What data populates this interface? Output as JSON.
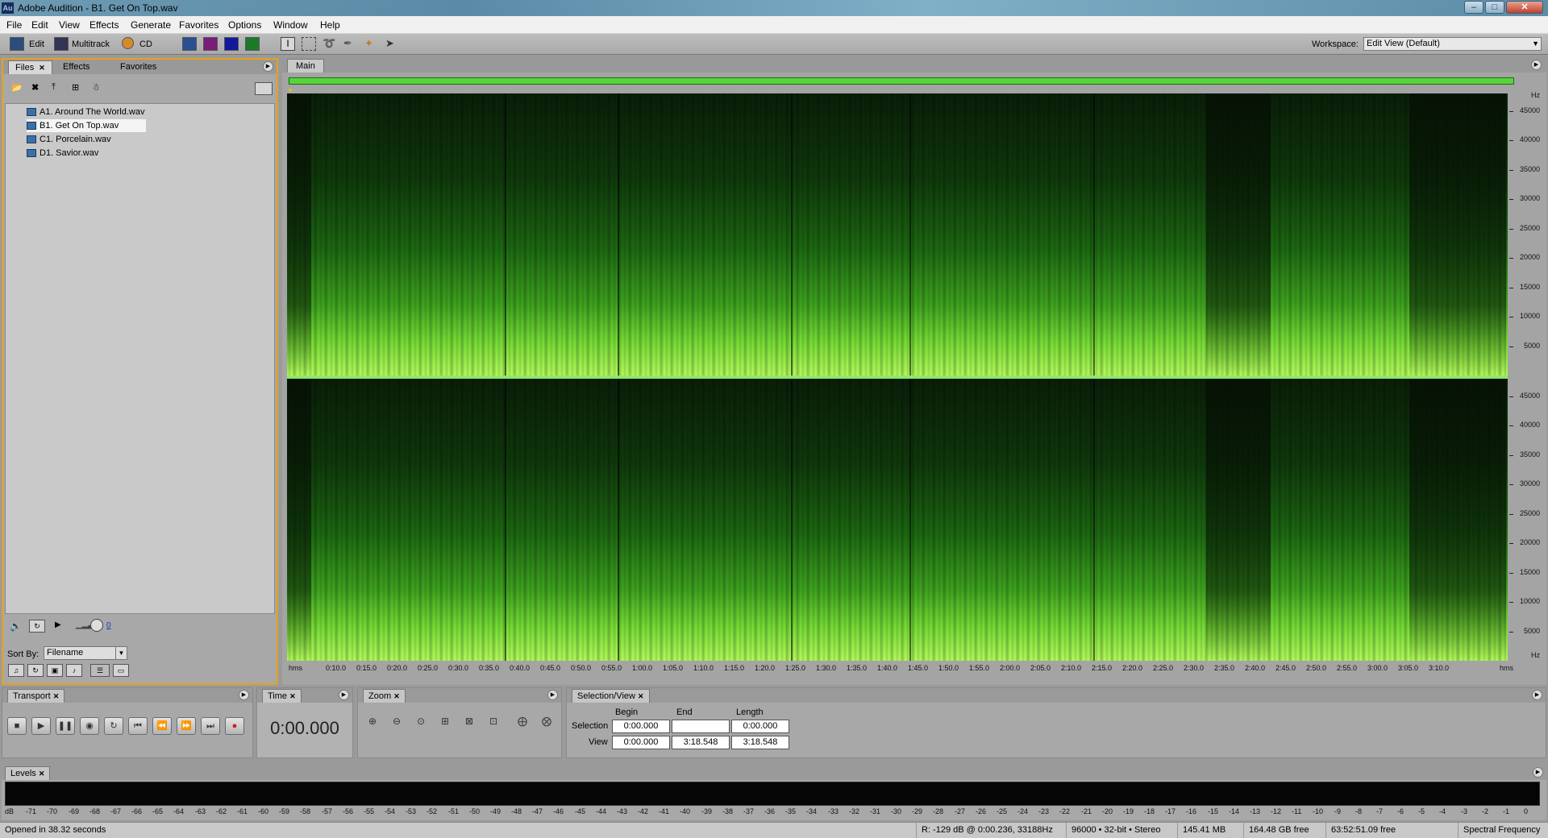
{
  "window": {
    "app_icon": "Au",
    "title": "Adobe Audition - B1. Get On Top.wav",
    "minimize": "–",
    "maximize": "□",
    "close": "✕"
  },
  "menu": [
    "File",
    "Edit",
    "View",
    "Effects",
    "Generate",
    "Favorites",
    "Options",
    "Window",
    "Help"
  ],
  "toolbar": {
    "modes": [
      "Edit",
      "Multitrack",
      "CD"
    ],
    "workspace_label": "Workspace:",
    "workspace_value": "Edit View (Default)"
  },
  "files_panel": {
    "tabs": [
      "Files",
      "Effects",
      "Favorites"
    ],
    "files": [
      "A1. Around The World.wav",
      "B1. Get On Top.wav",
      "C1. Porcelain.wav",
      "D1. Savior.wav"
    ],
    "selected_index": 1,
    "volume_value": "0",
    "sort_by_label": "Sort By:",
    "sort_by_value": "Filename"
  },
  "main_panel": {
    "tab": "Main",
    "freq_unit": "Hz",
    "freq_labels": [
      "45000",
      "40000",
      "35000",
      "30000",
      "25000",
      "20000",
      "15000",
      "10000",
      "5000"
    ],
    "time_unit_start": "hms",
    "time_unit_end": "hms",
    "time_labels": [
      "0:10.0",
      "0:15.0",
      "0:20.0",
      "0:25.0",
      "0:30.0",
      "0:35.0",
      "0:40.0",
      "0:45.0",
      "0:50.0",
      "0:55.0",
      "1:00.0",
      "1:05.0",
      "1:10.0",
      "1:15.0",
      "1:20.0",
      "1:25.0",
      "1:30.0",
      "1:35.0",
      "1:40.0",
      "1:45.0",
      "1:50.0",
      "1:55.0",
      "2:00.0",
      "2:05.0",
      "2:10.0",
      "2:15.0",
      "2:20.0",
      "2:25.0",
      "2:30.0",
      "2:35.0",
      "2:40.0",
      "2:45.0",
      "2:50.0",
      "2:55.0",
      "3:00.0",
      "3:05.0",
      "3:10.0"
    ]
  },
  "transport": {
    "tab": "Transport"
  },
  "time_panel": {
    "tab": "Time",
    "value": "0:00.000"
  },
  "zoom_panel": {
    "tab": "Zoom"
  },
  "selection_view": {
    "tab": "Selection/View",
    "headers": [
      "Begin",
      "End",
      "Length"
    ],
    "selection_label": "Selection",
    "view_label": "View",
    "selection": [
      "0:00.000",
      "",
      "0:00.000"
    ],
    "view": [
      "0:00.000",
      "3:18.548",
      "3:18.548"
    ]
  },
  "levels": {
    "tab": "Levels",
    "scale": [
      "dB",
      "-71",
      "-70",
      "-69",
      "-68",
      "-67",
      "-66",
      "-65",
      "-64",
      "-63",
      "-62",
      "-61",
      "-60",
      "-59",
      "-58",
      "-57",
      "-56",
      "-55",
      "-54",
      "-53",
      "-52",
      "-51",
      "-50",
      "-49",
      "-48",
      "-47",
      "-46",
      "-45",
      "-44",
      "-43",
      "-42",
      "-41",
      "-40",
      "-39",
      "-38",
      "-37",
      "-36",
      "-35",
      "-34",
      "-33",
      "-32",
      "-31",
      "-30",
      "-29",
      "-28",
      "-27",
      "-26",
      "-25",
      "-24",
      "-23",
      "-22",
      "-21",
      "-20",
      "-19",
      "-18",
      "-17",
      "-16",
      "-15",
      "-14",
      "-13",
      "-12",
      "-11",
      "-10",
      "-9",
      "-8",
      "-7",
      "-6",
      "-5",
      "-4",
      "-3",
      "-2",
      "-1",
      "0"
    ]
  },
  "status": {
    "left": "Opened in 38.32 seconds",
    "cursor": "R: -129 dB @  0:00.236, 33188Hz",
    "format": "96000 • 32-bit • Stereo",
    "size": "145.41 MB",
    "free": "164.48 GB free",
    "time_free": "63:52:51.09 free",
    "view_mode": "Spectral Frequency"
  },
  "colors": {
    "spectrogram_peak": "#b6ff5c",
    "spectrogram_base": "#0a1f08",
    "files_panel_border": "#e6a21a",
    "overview_bar": "#57d33b"
  }
}
